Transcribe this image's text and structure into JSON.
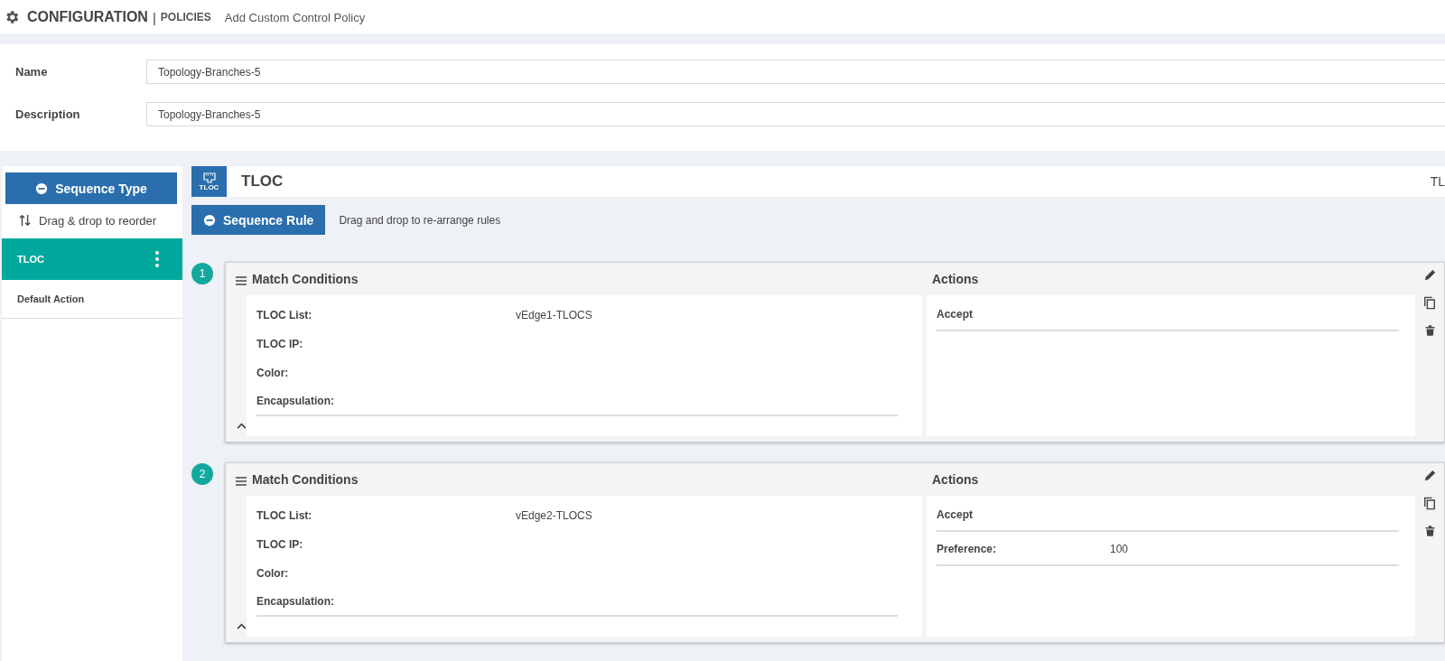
{
  "header": {
    "title": "CONFIGURATION",
    "separator": "|",
    "section": "POLICIES",
    "page": "Add Custom Control Policy"
  },
  "form": {
    "fields": [
      {
        "label": "Name",
        "value": "Topology-Branches-5"
      },
      {
        "label": "Description",
        "value": "Topology-Branches-5"
      }
    ]
  },
  "sidebar": {
    "sequence_type_button": "Sequence Type",
    "reorder_hint": "Drag & drop to reorder",
    "items": [
      {
        "label": "TLOC",
        "selected": true
      },
      {
        "label": "Default Action",
        "selected": false
      }
    ]
  },
  "main": {
    "icon_caption": "TLOC",
    "title": "TLOC",
    "right_label": "TL",
    "sequence_rule_button": "Sequence Rule",
    "rule_hint": "Drag and drop to re-arrange rules",
    "rules": [
      {
        "number": "1",
        "match_title": "Match Conditions",
        "actions_title": "Actions",
        "conditions": [
          {
            "label": "TLOC List:",
            "value": "vEdge1-TLOCS"
          },
          {
            "label": "TLOC IP:"
          },
          {
            "label": "Color:"
          },
          {
            "label": "Encapsulation:"
          }
        ],
        "actions": [
          {
            "label": "Accept"
          }
        ]
      },
      {
        "number": "2",
        "match_title": "Match Conditions",
        "actions_title": "Actions",
        "conditions": [
          {
            "label": "TLOC List:",
            "value": "vEdge2-TLOCS"
          },
          {
            "label": "TLOC IP:"
          },
          {
            "label": "Color:"
          },
          {
            "label": "Encapsulation:"
          }
        ],
        "actions": [
          {
            "label": "Accept"
          },
          {
            "label": "Preference:",
            "value": "100"
          }
        ]
      }
    ]
  }
}
